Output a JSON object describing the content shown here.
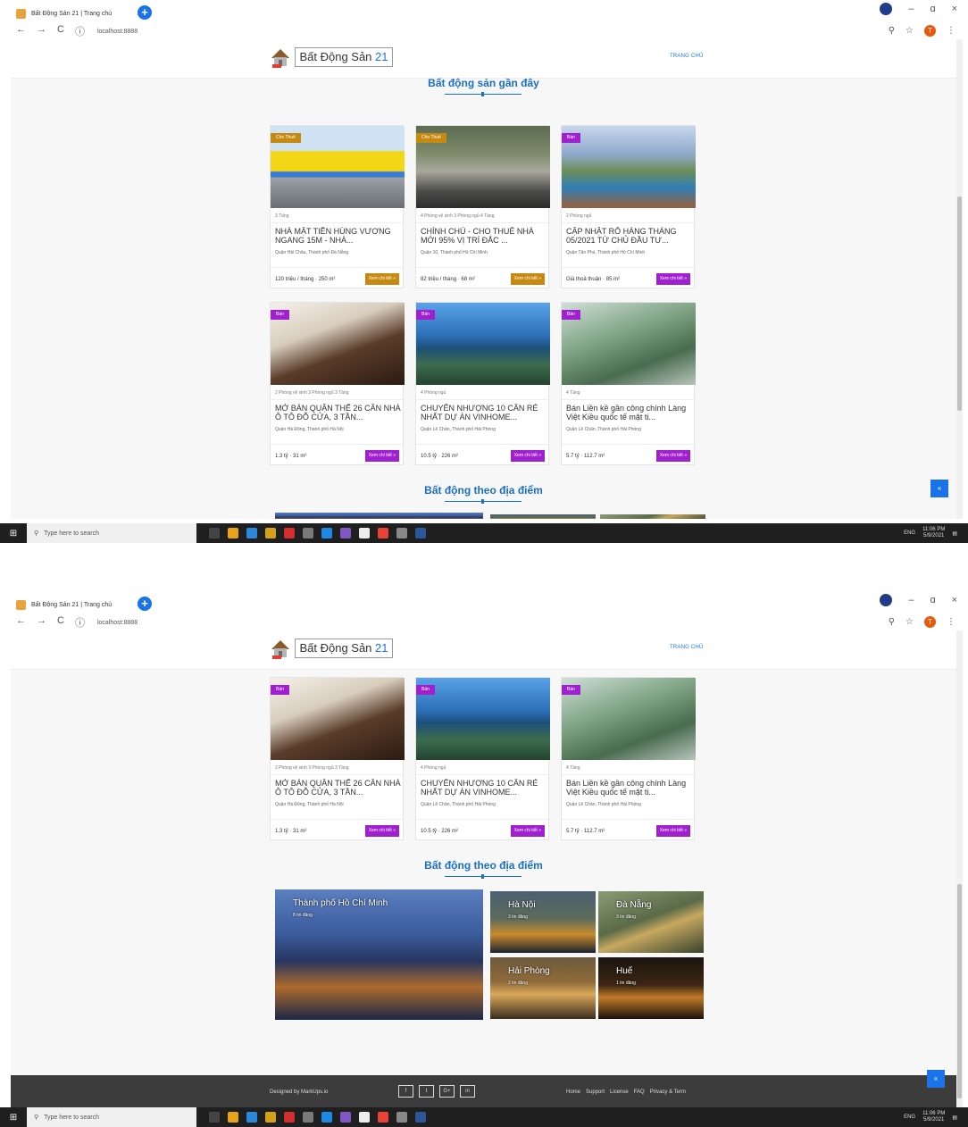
{
  "browser": {
    "tab_title": "Bất Động Sản 21 | Trang chủ",
    "tab_close": "×",
    "new_tab": "+",
    "url": "localhost:8888",
    "nav": {
      "back": "←",
      "forward": "→",
      "reload": "C",
      "info": "ⓘ"
    },
    "window": {
      "min": "–",
      "max": "ɑ",
      "close": "×"
    },
    "toolbar": {
      "zoom": "⚲",
      "star": "☆",
      "avatar": "T",
      "menu": "⋮"
    }
  },
  "site": {
    "logo_text": "Bất Động Sản",
    "logo_num": "21",
    "menu_home": "TRANG CHỦ"
  },
  "sections": {
    "recent_title": "Bất động sản gần đây",
    "location_title": "Bất động theo địa điểm"
  },
  "listings": [
    {
      "badge": "Cho Thuê",
      "kind": "rent",
      "meta": "3 Tầng",
      "title": "NHÀ MẶT TIỀN HÙNG VƯƠNG NGANG 15M - NHÀ...",
      "location": "Quận Hải Châu, Thành phố Đà Nẵng",
      "price": "120 triệu / tháng  ·  250 m²",
      "button": "Xem chi tiết »"
    },
    {
      "badge": "Cho Thuê",
      "kind": "rent",
      "meta": "4 Phòng vệ sinh   3 Phòng ngủ   4 Tầng",
      "title": "CHÍNH CHỦ - CHO THUÊ NHÀ MỚI 95% VỊ TRÍ ĐẮC ...",
      "location": "Quận 10, Thành phố Hồ Chí Minh",
      "price": "82 triệu / tháng  ·  68 m²",
      "button": "Xem chi tiết »"
    },
    {
      "badge": "Bán",
      "kind": "sale",
      "meta": "2 Phòng ngủ",
      "title": "CẬP NHẬT RỔ HÀNG THÁNG 05/2021 TỪ CHỦ ĐẦU TƯ...",
      "location": "Quận Tân Phú, Thành phố Hồ Chí Minh",
      "price": "Giá thoả thuận  ·  85 m²",
      "button": "Xem chi tiết »"
    },
    {
      "badge": "Bán",
      "kind": "sale",
      "meta": "2 Phòng vệ sinh   3 Phòng ngủ   3 Tầng",
      "title": "MỞ BÁN QUẬN THẾ 26 CĂN NHÀ Ô TÔ ĐỖ CỬA, 3 TẦN...",
      "location": "Quận Hà Đông, Thành phố Hà Nội",
      "price": "1.3 tỷ  ·  31 m²",
      "button": "Xem chi tiết »"
    },
    {
      "badge": "Bán",
      "kind": "sale",
      "meta": "4 Phòng ngủ",
      "title": "CHUYỂN NHƯỢNG 10 CĂN RẺ NHẤT DỰ ÁN VINHOME...",
      "location": "Quận Lê Chân, Thành phố Hải Phòng",
      "price": "10.5 tỷ  ·  226 m²",
      "button": "Xem chi tiết »"
    },
    {
      "badge": "Bán",
      "kind": "sale",
      "meta": "4 Tầng",
      "title": "Bán Liền kề gần công chính Làng Việt Kiều quốc tế mặt ti...",
      "location": "Quận Lê Chân, Thành phố Hải Phòng",
      "price": "5.7 tỷ  ·  112.7 m²",
      "button": "Xem chi tiết »"
    }
  ],
  "locations": [
    {
      "name": "Thành phố Hồ Chí Minh",
      "count": "8 tin đăng"
    },
    {
      "name": "Hà Nội",
      "count": "3 tin đăng"
    },
    {
      "name": "Đà Nẵng",
      "count": "3 tin đăng"
    },
    {
      "name": "Hải Phòng",
      "count": "2 tin đăng"
    },
    {
      "name": "Huế",
      "count": "1 tin đăng"
    }
  ],
  "footer": {
    "designed": "Designed by MarkUps.io",
    "socials": [
      "f",
      "t",
      "G+",
      "in"
    ],
    "links": [
      "Home",
      "Support",
      "License",
      "FAQ",
      "Privacy & Term"
    ]
  },
  "to_top": "«",
  "taskbar": {
    "start": "⊞",
    "search_placeholder": "Type here to search",
    "tray": "ENG",
    "time": "11:06 PM",
    "date": "5/9/2021"
  },
  "colors": {
    "accent": "#1a6fc9",
    "rent": "#c78a10",
    "sale": "#a020d0",
    "footer": "#3c3c3c"
  }
}
